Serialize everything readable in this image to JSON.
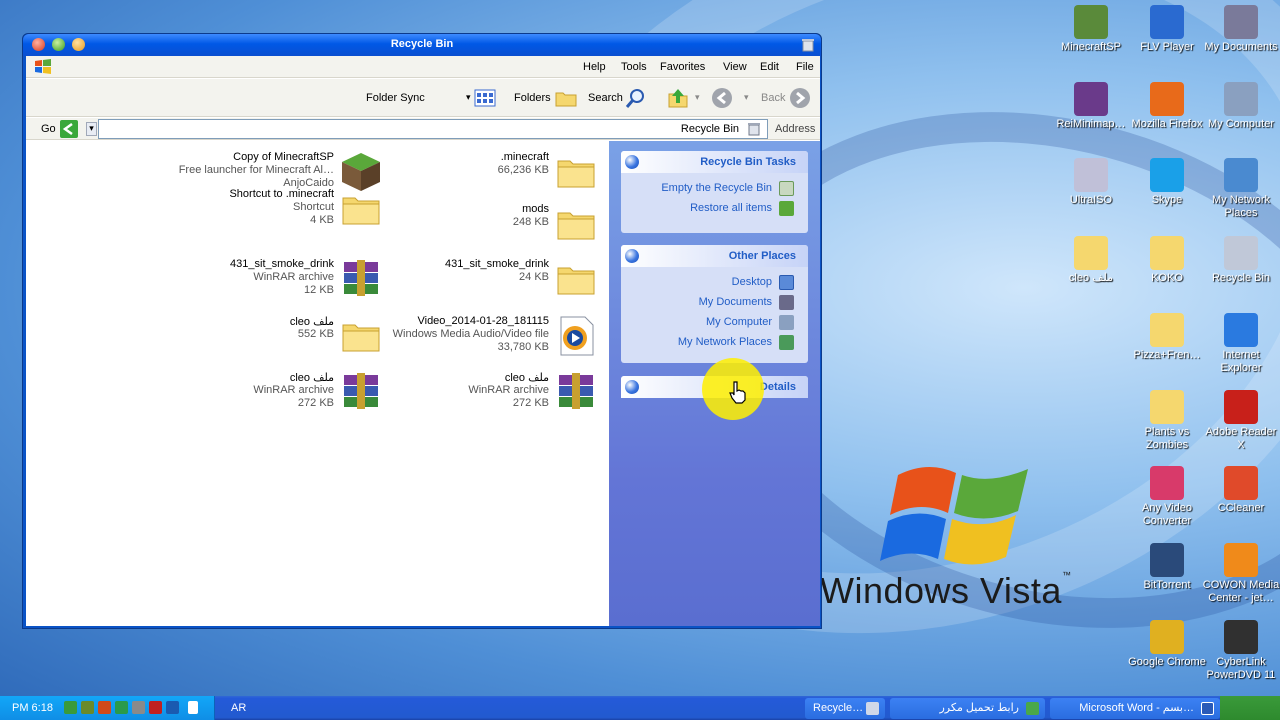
{
  "window": {
    "title": "Recycle Bin",
    "menu": [
      "Help",
      "Tools",
      "Favorites",
      "View",
      "Edit",
      "File"
    ],
    "toolbar": {
      "folder_sync": "Folder Sync",
      "folders": "Folders",
      "search": "Search",
      "back": "Back"
    },
    "address": {
      "go": "Go",
      "value": "Recycle Bin",
      "label": "Address"
    }
  },
  "files": [
    {
      "name": "Copy of MinecraftSP",
      "type": "Free launcher for Minecraft Al…",
      "size": "AnjoCaido",
      "icon": "minecraft-icon"
    },
    {
      "name": ".minecraft",
      "type": "66,236 KB",
      "size": "",
      "icon": "folder-icon"
    },
    {
      "name": "Shortcut to .minecraft",
      "type": "Shortcut",
      "size": "4 KB",
      "icon": "folder-icon"
    },
    {
      "name": "mods",
      "type": "248 KB",
      "size": "",
      "icon": "folder-icon"
    },
    {
      "name": "431_sit_smoke_drink",
      "type": "WinRAR archive",
      "size": "12 KB",
      "icon": "winrar-icon"
    },
    {
      "name": "431_sit_smoke_drink",
      "type": "24 KB",
      "size": "",
      "icon": "folder-icon"
    },
    {
      "name": "cleo ملف",
      "type": "552 KB",
      "size": "",
      "icon": "folder-icon"
    },
    {
      "name": "Video_2014-01-28_181115",
      "type": "Windows Media Audio/Video file",
      "size": "33,780 KB",
      "icon": "media-file-icon"
    },
    {
      "name": "cleo ملف",
      "type": "WinRAR archive",
      "size": "272 KB",
      "icon": "winrar-icon"
    },
    {
      "name": "cleo ملف",
      "type": "WinRAR archive",
      "size": "272 KB",
      "icon": "winrar-icon"
    }
  ],
  "tasks": {
    "recycle_title": "Recycle Bin Tasks",
    "empty": "Empty the Recycle Bin",
    "restore": "Restore all items",
    "other_title": "Other Places",
    "desktop": "Desktop",
    "my_documents": "My Documents",
    "my_computer": "My Computer",
    "my_network": "My Network Places",
    "details_title": "Details"
  },
  "desktop_icons": [
    {
      "label": "MinecraftSP",
      "color": "#5a8a3a"
    },
    {
      "label": "FLV Player",
      "color": "#2a6ad0"
    },
    {
      "label": "My Documents",
      "color": "#7a7a9a"
    },
    {
      "label": "ReiMinimap…",
      "color": "#6a3a8a"
    },
    {
      "label": "Mozilla Firefox",
      "color": "#e86a1a"
    },
    {
      "label": "My Computer",
      "color": "#8aa0c0"
    },
    {
      "label": "UltraISO",
      "color": "#c0c0d8"
    },
    {
      "label": "Skype",
      "color": "#1aa0e8"
    },
    {
      "label": "My Network Places",
      "color": "#4a8ad0"
    },
    {
      "label": "cleo ملف",
      "color": "#f5d76e"
    },
    {
      "label": "KOKO",
      "color": "#f5d76e"
    },
    {
      "label": "Recycle Bin",
      "color": "#c0c8d8"
    },
    {
      "label": "Pizza+Fren…",
      "color": "#f5d76e"
    },
    {
      "label": "Internet Explorer",
      "color": "#2a7ae0"
    },
    {
      "label": "Plants vs Zombies",
      "color": "#f5d76e"
    },
    {
      "label": "Adobe Reader X",
      "color": "#c8201a"
    },
    {
      "label": "Any Video Converter",
      "color": "#d83a6a"
    },
    {
      "label": "CCleaner",
      "color": "#e04a2a"
    },
    {
      "label": "BitTorrent",
      "color": "#2a4a7a"
    },
    {
      "label": "COWON Media Center - jet…",
      "color": "#f08a1a"
    },
    {
      "label": "Google Chrome",
      "color": "#e0b020"
    },
    {
      "label": "CyberLink PowerDVD 11",
      "color": "#303030"
    }
  ],
  "vista": {
    "text": "Windows Vista",
    "tm": "™"
  },
  "taskbar": {
    "clock": "PM 6:18",
    "lang": "AR",
    "recycle_task": "Recycle…",
    "arabic_task": "رابط تحميل مكرر",
    "word_task": "Microsoft Word - بسم…"
  }
}
